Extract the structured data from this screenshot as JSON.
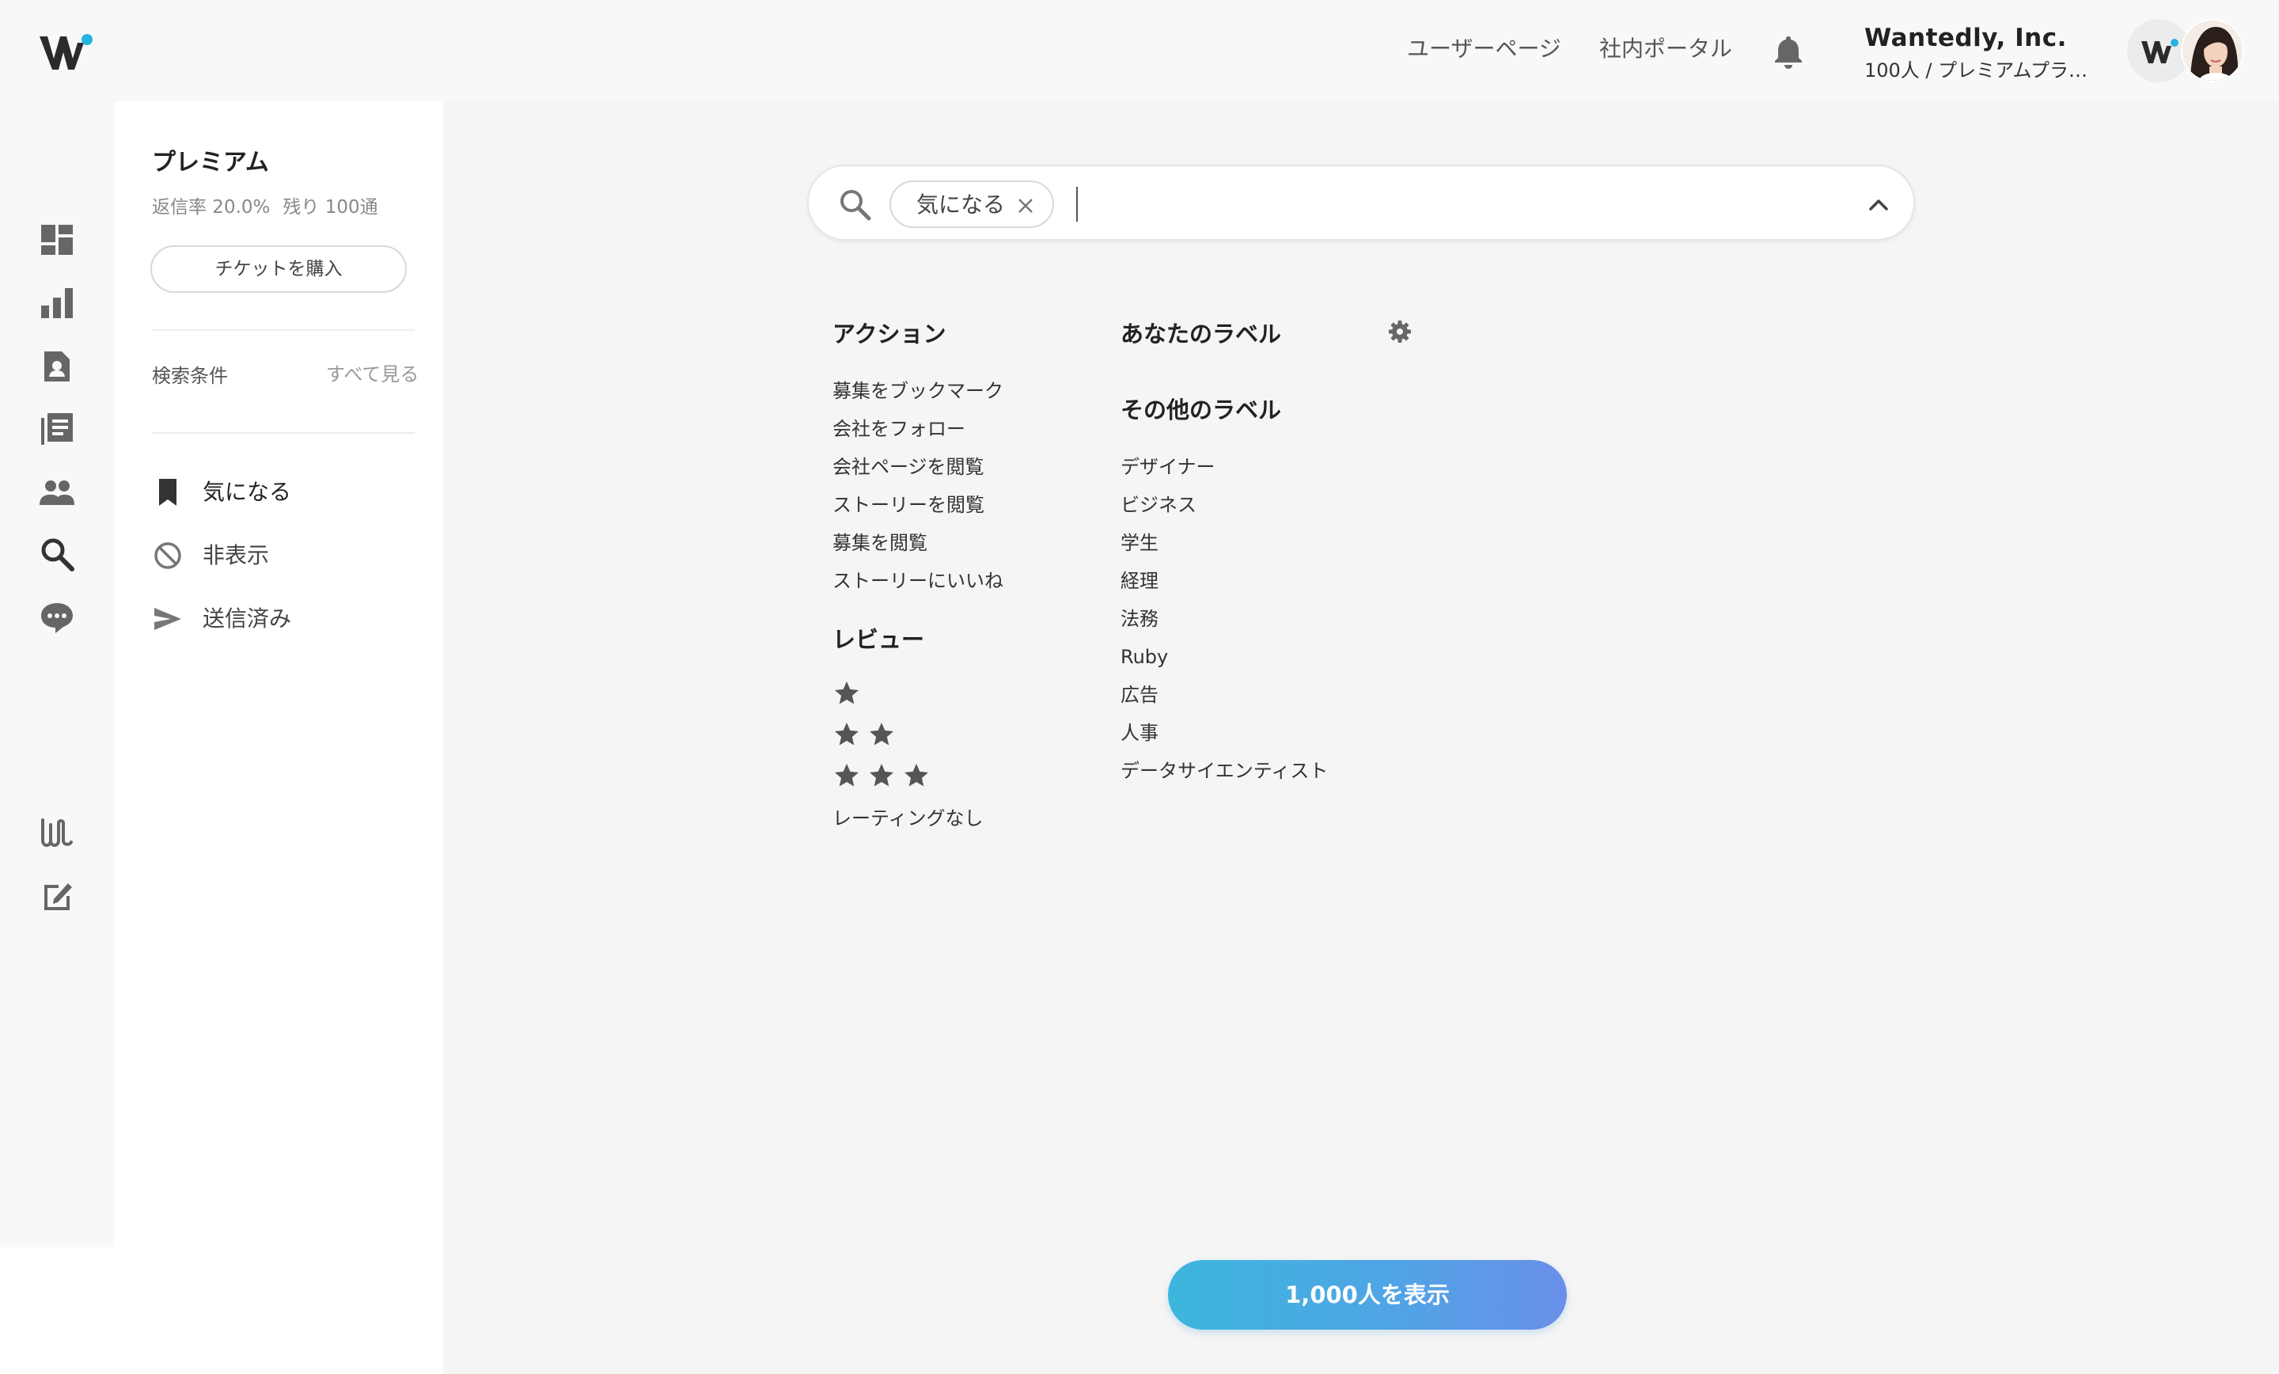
{
  "header": {
    "nav_user_page": "ユーザーページ",
    "nav_company_portal": "社内ポータル",
    "company_name": "Wantedly, Inc.",
    "company_plan": "100人 / プレミアムプラン..."
  },
  "sidebar": {
    "plan_title": "プレミアム",
    "reply_rate": "返信率 20.0%",
    "remaining": "残り 100通",
    "ticket_button": "チケットを購入",
    "conditions_label": "検索条件",
    "see_all": "すべて見る",
    "items": [
      {
        "label": "気になる",
        "icon": "bookmark-icon"
      },
      {
        "label": "非表示",
        "icon": "block-icon"
      },
      {
        "label": "送信済み",
        "icon": "send-icon"
      }
    ]
  },
  "search": {
    "chip_label": "気になる",
    "input_value": "",
    "input_placeholder": ""
  },
  "filters": {
    "actions": {
      "heading": "アクション",
      "options": [
        "募集をブックマーク",
        "会社をフォロー",
        "会社ページを閲覧",
        "ストーリーを閲覧",
        "募集を閲覧",
        "ストーリーにいいね"
      ]
    },
    "review": {
      "heading": "レビュー",
      "star_options": [
        1,
        2,
        3
      ],
      "no_rating": "レーティングなし"
    },
    "your_labels": {
      "heading": "あなたのラベル"
    },
    "other_labels": {
      "heading": "その他のラベル",
      "options": [
        "デザイナー",
        "ビジネス",
        "学生",
        "経理",
        "法務",
        "Ruby",
        "広告",
        "人事",
        "データサイエンティスト"
      ]
    }
  },
  "result_button": "1,000人を表示",
  "colors": {
    "accent_gradient_start": "#3cb6dc",
    "accent_gradient_end": "#6a8fe8",
    "logo_dot": "#23b4e0",
    "icon_gray": "#555555"
  }
}
